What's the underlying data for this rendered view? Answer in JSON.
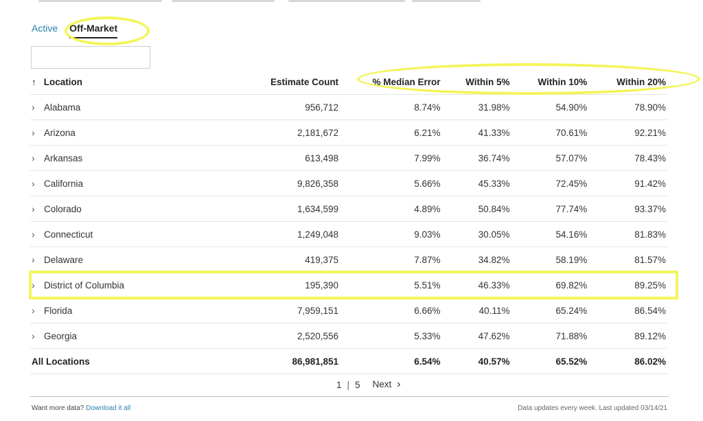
{
  "tabs": [
    {
      "label": "Active"
    },
    {
      "label": "Off-Market"
    }
  ],
  "search": {
    "value": ""
  },
  "table": {
    "headers": [
      "Location",
      "Estimate Count",
      "% Median Error",
      "Within 5%",
      "Within 10%",
      "Within 20%"
    ],
    "sort_icon": "↑",
    "rows": [
      [
        "Alabama",
        "956,712",
        "8.74%",
        "31.98%",
        "54.90%",
        "78.90%"
      ],
      [
        "Arizona",
        "2,181,672",
        "6.21%",
        "41.33%",
        "70.61%",
        "92.21%"
      ],
      [
        "Arkansas",
        "613,498",
        "7.99%",
        "36.74%",
        "57.07%",
        "78.43%"
      ],
      [
        "California",
        "9,826,358",
        "5.66%",
        "45.33%",
        "72.45%",
        "91.42%"
      ],
      [
        "Colorado",
        "1,634,599",
        "4.89%",
        "50.84%",
        "77.74%",
        "93.37%"
      ],
      [
        "Connecticut",
        "1,249,048",
        "9.03%",
        "30.05%",
        "54.16%",
        "81.83%"
      ],
      [
        "Delaware",
        "419,375",
        "7.87%",
        "34.82%",
        "58.19%",
        "81.57%"
      ],
      [
        "District of Columbia",
        "195,390",
        "5.51%",
        "46.33%",
        "69.82%",
        "89.25%"
      ],
      [
        "Florida",
        "7,959,151",
        "6.66%",
        "40.11%",
        "65.24%",
        "86.54%"
      ],
      [
        "Georgia",
        "2,520,556",
        "5.33%",
        "47.62%",
        "71.88%",
        "89.12%"
      ]
    ],
    "total": [
      "All Locations",
      "86,981,851",
      "6.54%",
      "40.57%",
      "65.52%",
      "86.02%"
    ]
  },
  "pagination": {
    "current": "1",
    "separator": "|",
    "total": "5",
    "next_label": "Next",
    "next_icon": "›"
  },
  "footer": {
    "left_text": "Want more data? ",
    "left_link": "Download it all",
    "right_text": "Data updates every week. Last updated 03/14/21"
  },
  "colors": {
    "accent": "#2a7fb0",
    "highlight": "#f4f45a"
  }
}
